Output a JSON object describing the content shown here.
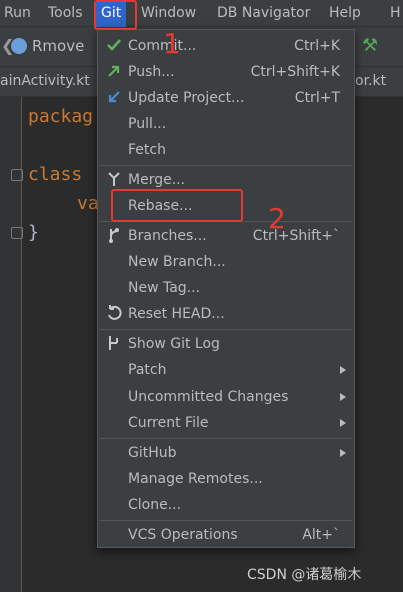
{
  "menubar": {
    "items": [
      "Run",
      "Tools",
      "Git",
      "Window",
      "DB Navigator",
      "Help",
      "H"
    ]
  },
  "toolbar": {
    "run_config": "Rmove"
  },
  "tabs": {
    "left": "ainActivity.kt",
    "right": "or.kt"
  },
  "editor": {
    "line1": "packag",
    "line2_kw": "class",
    "line3": "va",
    "line4": "}"
  },
  "git_menu": {
    "items": [
      {
        "label": "Commit...",
        "shortcut": "Ctrl+K",
        "icon": "check-icon"
      },
      {
        "label": "Push...",
        "shortcut": "Ctrl+Shift+K",
        "icon": "push-arrow-icon"
      },
      {
        "label": "Update Project...",
        "shortcut": "Ctrl+T",
        "icon": "update-arrow-icon"
      },
      {
        "label": "Pull...",
        "shortcut": ""
      },
      {
        "label": "Fetch",
        "shortcut": ""
      },
      {
        "label": "Merge...",
        "shortcut": "",
        "icon": "merge-icon"
      },
      {
        "label": "Rebase...",
        "shortcut": ""
      },
      {
        "label": "Branches...",
        "shortcut": "Ctrl+Shift+`",
        "icon": "branch-icon"
      },
      {
        "label": "New Branch...",
        "shortcut": ""
      },
      {
        "label": "New Tag...",
        "shortcut": ""
      },
      {
        "label": "Reset HEAD...",
        "shortcut": "",
        "icon": "undo-icon"
      },
      {
        "label": "Show Git Log",
        "shortcut": "",
        "icon": "git-log-icon"
      },
      {
        "label": "Patch",
        "shortcut": "",
        "submenu": true
      },
      {
        "label": "Uncommitted Changes",
        "shortcut": "",
        "submenu": true
      },
      {
        "label": "Current File",
        "shortcut": "",
        "submenu": true
      },
      {
        "label": "GitHub",
        "shortcut": "",
        "submenu": true
      },
      {
        "label": "Manage Remotes...",
        "shortcut": ""
      },
      {
        "label": "Clone...",
        "shortcut": ""
      },
      {
        "label": "VCS Operations",
        "shortcut": "Alt+`"
      }
    ]
  },
  "annotations": {
    "step1": "1",
    "step2": "2"
  },
  "watermark": "CSDN @诸葛榆木",
  "colors": {
    "highlight": "#2f65ca",
    "annotation": "#e53935",
    "check": "#5fb05f",
    "keyword": "#cc7832"
  }
}
